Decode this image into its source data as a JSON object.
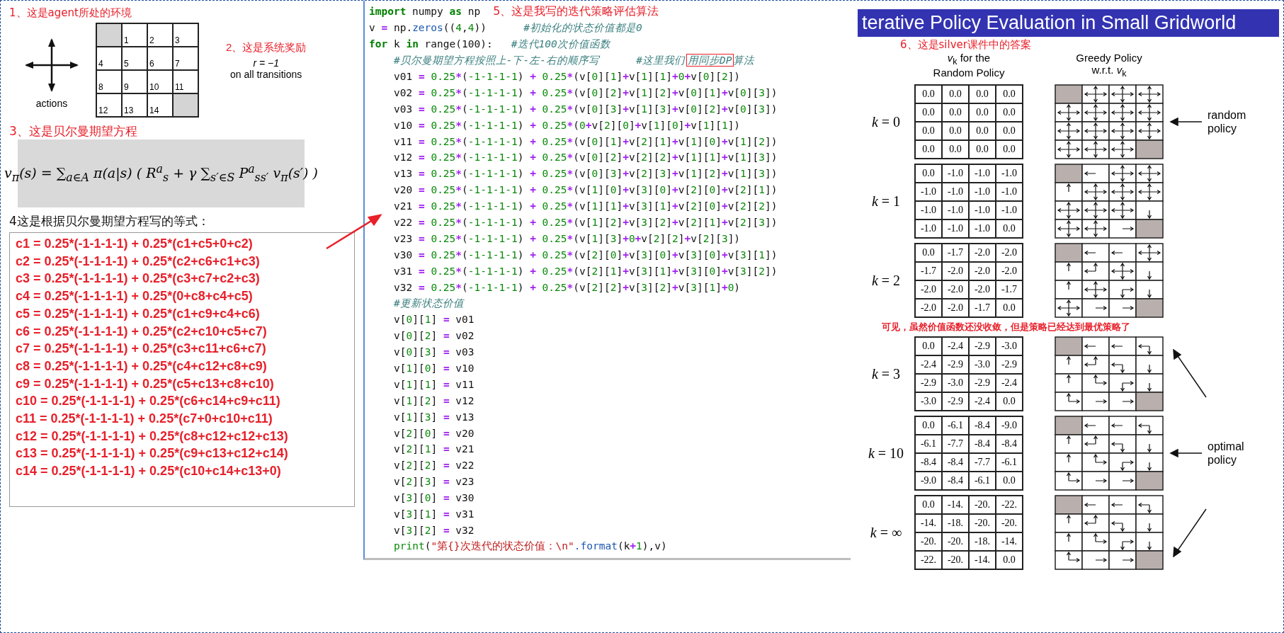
{
  "left": {
    "env_title": "1、这是agent所处的环境",
    "actions_label": "actions",
    "environment": {
      "cells": [
        {
          "terminal": true
        },
        {
          "terminal": false,
          "number": "1"
        },
        {
          "terminal": false,
          "number": "2"
        },
        {
          "terminal": false,
          "number": "3"
        },
        {
          "terminal": false,
          "number": "4"
        },
        {
          "terminal": false,
          "number": "5"
        },
        {
          "terminal": false,
          "number": "6"
        },
        {
          "terminal": false,
          "number": "7"
        },
        {
          "terminal": false,
          "number": "8"
        },
        {
          "terminal": false,
          "number": "9"
        },
        {
          "terminal": false,
          "number": "10"
        },
        {
          "terminal": false,
          "number": "11"
        },
        {
          "terminal": false,
          "number": "12"
        },
        {
          "terminal": false,
          "number": "13"
        },
        {
          "terminal": false,
          "number": "14"
        },
        {
          "terminal": true
        }
      ]
    },
    "reward_title": "2、这是系统奖励",
    "reward": "r = −1",
    "reward_note": "on all transitions",
    "bellman_title": "3、这是贝尔曼期望方程",
    "equation": "v$_{π}$(s) = ∑$_{a∈A}$ π(a|s) ( R$^{a}$$_{s}$ + γ ∑$_{s′∈S}$ P$^{a}$$_{ss′}$ v$_{π}$(s′) )",
    "equations_title": "4这是根据贝尔曼期望方程写的等式：",
    "equations": [
      "c1 = 0.25*(-1-1-1-1) + 0.25*(c1+c5+0+c2)",
      "c2 = 0.25*(-1-1-1-1) + 0.25*(c2+c6+c1+c3)",
      "c3 = 0.25*(-1-1-1-1) + 0.25*(c3+c7+c2+c3)",
      "c4 = 0.25*(-1-1-1-1) + 0.25*(0+c8+c4+c5)",
      "c5 = 0.25*(-1-1-1-1) + 0.25*(c1+c9+c4+c6)",
      "c6 = 0.25*(-1-1-1-1) + 0.25*(c2+c10+c5+c7)",
      "c7 = 0.25*(-1-1-1-1) + 0.25*(c3+c11+c6+c7)",
      "c8 = 0.25*(-1-1-1-1) + 0.25*(c4+c12+c8+c9)",
      "c9 = 0.25*(-1-1-1-1) + 0.25*(c5+c13+c8+c10)",
      "c10 = 0.25*(-1-1-1-1) + 0.25*(c6+c14+c9+c11)",
      "c11 = 0.25*(-1-1-1-1) + 0.25*(c7+0+c10+c11)",
      "c12 = 0.25*(-1-1-1-1) + 0.25*(c8+c12+c12+c13)",
      "c13 = 0.25*(-1-1-1-1) + 0.25*(c9+c13+c12+c14)",
      "c14 = 0.25*(-1-1-1-1) + 0.25*(c10+c14+c13+0)"
    ]
  },
  "code": {
    "lines": [
      {
        "indented": false,
        "note": "5、这是我写的迭代策略评估算法",
        "segments": [
          {
            "kind": "kw",
            "text": "import"
          },
          {
            "kind": "plain",
            "text": " numpy "
          },
          {
            "kind": "kw",
            "text": "as"
          },
          {
            "kind": "plain",
            "text": " np"
          }
        ]
      },
      {
        "indented": false,
        "segments": [
          {
            "kind": "code",
            "text": "v = np."
          },
          {
            "kind": "fn",
            "text": "zeros"
          },
          {
            "kind": "code",
            "text": "((4,4))"
          },
          {
            "kind": "comment",
            "text": "      #初始化的状态价值都是0"
          }
        ]
      },
      {
        "indented": false,
        "segments": [
          {
            "kind": "kw",
            "text": "for"
          },
          {
            "kind": "plain",
            "text": " k "
          },
          {
            "kind": "kw",
            "text": "in"
          },
          {
            "kind": "plain",
            "text": " range(100):"
          },
          {
            "kind": "comment",
            "text": "   #迭代100次价值函数"
          }
        ]
      },
      {
        "indented": true,
        "segments": [
          {
            "kind": "comment",
            "text": "#贝尔曼期望方程按照上-下-左-右的顺序写"
          },
          {
            "kind": "comment",
            "text": "      #这里我们"
          },
          {
            "kind": "boxed",
            "text": "用同步DP"
          },
          {
            "kind": "comment",
            "text": "算法"
          }
        ]
      },
      {
        "indented": true,
        "segments": [
          {
            "kind": "code",
            "text": "v01 = 0.25*(-1-1-1-1) + 0.25*(v[0][1]+v[1][1]+0+v[0][2])"
          }
        ]
      },
      {
        "indented": true,
        "segments": [
          {
            "kind": "code",
            "text": "v02 = 0.25*(-1-1-1-1) + 0.25*(v[0][2]+v[1][2]+v[0][1]+v[0][3])"
          }
        ]
      },
      {
        "indented": true,
        "segments": [
          {
            "kind": "code",
            "text": "v03 = 0.25*(-1-1-1-1) + 0.25*(v[0][3]+v[1][3]+v[0][2]+v[0][3])"
          }
        ]
      },
      {
        "indented": true,
        "segments": [
          {
            "kind": "code",
            "text": "v10 = 0.25*(-1-1-1-1) + 0.25*(0+v[2][0]+v[1][0]+v[1][1])"
          }
        ]
      },
      {
        "indented": true,
        "segments": [
          {
            "kind": "code",
            "text": "v11 = 0.25*(-1-1-1-1) + 0.25*(v[0][1]+v[2][1]+v[1][0]+v[1][2])"
          }
        ]
      },
      {
        "indented": true,
        "segments": [
          {
            "kind": "code",
            "text": "v12 = 0.25*(-1-1-1-1) + 0.25*(v[0][2]+v[2][2]+v[1][1]+v[1][3])"
          }
        ]
      },
      {
        "indented": true,
        "segments": [
          {
            "kind": "code",
            "text": "v13 = 0.25*(-1-1-1-1) + 0.25*(v[0][3]+v[2][3]+v[1][2]+v[1][3])"
          }
        ]
      },
      {
        "indented": true,
        "segments": [
          {
            "kind": "code",
            "text": "v20 = 0.25*(-1-1-1-1) + 0.25*(v[1][0]+v[3][0]+v[2][0]+v[2][1])"
          }
        ]
      },
      {
        "indented": true,
        "segments": [
          {
            "kind": "code",
            "text": "v21 = 0.25*(-1-1-1-1) + 0.25*(v[1][1]+v[3][1]+v[2][0]+v[2][2])"
          }
        ]
      },
      {
        "indented": true,
        "segments": [
          {
            "kind": "code",
            "text": "v22 = 0.25*(-1-1-1-1) + 0.25*(v[1][2]+v[3][2]+v[2][1]+v[2][3])"
          }
        ]
      },
      {
        "indented": true,
        "segments": [
          {
            "kind": "code",
            "text": "v23 = 0.25*(-1-1-1-1) + 0.25*(v[1][3]+0+v[2][2]+v[2][3])"
          }
        ]
      },
      {
        "indented": true,
        "segments": [
          {
            "kind": "code",
            "text": "v30 = 0.25*(-1-1-1-1) + 0.25*(v[2][0]+v[3][0]+v[3][0]+v[3][1])"
          }
        ]
      },
      {
        "indented": true,
        "segments": [
          {
            "kind": "code",
            "text": "v31 = 0.25*(-1-1-1-1) + 0.25*(v[2][1]+v[3][1]+v[3][0]+v[3][2])"
          }
        ]
      },
      {
        "indented": true,
        "segments": [
          {
            "kind": "code",
            "text": "v32 = 0.25*(-1-1-1-1) + 0.25*(v[2][2]+v[3][2]+v[3][1]+0)"
          }
        ]
      },
      {
        "indented": true,
        "segments": [
          {
            "kind": "comment",
            "text": "#更新状态价值"
          }
        ]
      },
      {
        "indented": true,
        "segments": [
          {
            "kind": "code",
            "text": "v[0][1] = v01"
          }
        ]
      },
      {
        "indented": true,
        "segments": [
          {
            "kind": "code",
            "text": "v[0][2] = v02"
          }
        ]
      },
      {
        "indented": true,
        "segments": [
          {
            "kind": "code",
            "text": "v[0][3] = v03"
          }
        ]
      },
      {
        "indented": true,
        "segments": [
          {
            "kind": "code",
            "text": "v[1][0] = v10"
          }
        ]
      },
      {
        "indented": true,
        "segments": [
          {
            "kind": "code",
            "text": "v[1][1] = v11"
          }
        ]
      },
      {
        "indented": true,
        "segments": [
          {
            "kind": "code",
            "text": "v[1][2] = v12"
          }
        ]
      },
      {
        "indented": true,
        "segments": [
          {
            "kind": "code",
            "text": "v[1][3] = v13"
          }
        ]
      },
      {
        "indented": true,
        "segments": [
          {
            "kind": "code",
            "text": "v[2][0] = v20"
          }
        ]
      },
      {
        "indented": true,
        "segments": [
          {
            "kind": "code",
            "text": "v[2][1] = v21"
          }
        ]
      },
      {
        "indented": true,
        "segments": [
          {
            "kind": "code",
            "text": "v[2][2] = v22"
          }
        ]
      },
      {
        "indented": true,
        "segments": [
          {
            "kind": "code",
            "text": "v[2][3] = v23"
          }
        ]
      },
      {
        "indented": true,
        "segments": [
          {
            "kind": "code",
            "text": "v[3][0] = v30"
          }
        ]
      },
      {
        "indented": true,
        "segments": [
          {
            "kind": "code",
            "text": "v[3][1] = v31"
          }
        ]
      },
      {
        "indented": true,
        "segments": [
          {
            "kind": "code",
            "text": "v[3][2] = v32"
          }
        ]
      },
      {
        "indented": true,
        "segments": [
          {
            "kind": "builtin",
            "text": "print"
          },
          {
            "kind": "plain",
            "text": "("
          },
          {
            "kind": "str",
            "text": "\"第{}次迭代的状态价值：\\n\""
          },
          {
            "kind": "fn",
            "text": ".format"
          },
          {
            "kind": "code",
            "text": "(k+1),v)"
          }
        ]
      }
    ]
  },
  "slide": {
    "title": "terative Policy Evaluation in Small Gridworld",
    "annotation": "6、这是silver课件中的答案",
    "value_header": [
      "*v*$_{k}$ for the",
      "Random Policy"
    ],
    "policy_header": [
      "Greedy Policy",
      "w.r.t. *v*$_{k}$"
    ],
    "rows": [
      {
        "label": "*k* = 0",
        "values": [
          "0.0",
          "0.0",
          "0.0",
          "0.0",
          "0.0",
          "0.0",
          "0.0",
          "0.0",
          "0.0",
          "0.0",
          "0.0",
          "0.0",
          "0.0",
          "0.0",
          "0.0",
          "0.0"
        ],
        "policy": [
          {
            "terminal": true,
            "up": false,
            "right": false,
            "down": false,
            "left": false
          },
          {
            "terminal": false,
            "up": true,
            "right": true,
            "down": true,
            "left": true
          },
          {
            "terminal": false,
            "up": true,
            "right": true,
            "down": true,
            "left": true
          },
          {
            "terminal": false,
            "up": true,
            "right": true,
            "down": true,
            "left": true
          },
          {
            "terminal": false,
            "up": true,
            "right": true,
            "down": true,
            "left": true
          },
          {
            "terminal": false,
            "up": true,
            "right": true,
            "down": true,
            "left": true
          },
          {
            "terminal": false,
            "up": true,
            "right": true,
            "down": true,
            "left": true
          },
          {
            "terminal": false,
            "up": true,
            "right": true,
            "down": true,
            "left": true
          },
          {
            "terminal": false,
            "up": true,
            "right": true,
            "down": true,
            "left": true
          },
          {
            "terminal": false,
            "up": true,
            "right": true,
            "down": true,
            "left": true
          },
          {
            "terminal": false,
            "up": true,
            "right": true,
            "down": true,
            "left": true
          },
          {
            "terminal": false,
            "up": true,
            "right": true,
            "down": true,
            "left": true
          },
          {
            "terminal": false,
            "up": true,
            "right": true,
            "down": true,
            "left": true
          },
          {
            "terminal": false,
            "up": true,
            "right": true,
            "down": true,
            "left": true
          },
          {
            "terminal": false,
            "up": true,
            "right": true,
            "down": true,
            "left": true
          },
          {
            "terminal": true,
            "up": false,
            "right": false,
            "down": false,
            "left": false
          }
        ],
        "pointer": {
          "kind": "left"
        },
        "note": "random policy"
      },
      {
        "label": "*k* = 1",
        "values": [
          "0.0",
          "-1.0",
          "-1.0",
          "-1.0",
          "-1.0",
          "-1.0",
          "-1.0",
          "-1.0",
          "-1.0",
          "-1.0",
          "-1.0",
          "-1.0",
          "-1.0",
          "-1.0",
          "-1.0",
          "0.0"
        ],
        "policy": [
          {
            "terminal": true,
            "up": false,
            "right": false,
            "down": false,
            "left": false
          },
          {
            "terminal": false,
            "up": false,
            "right": false,
            "down": false,
            "left": true
          },
          {
            "terminal": false,
            "up": true,
            "right": true,
            "down": true,
            "left": true
          },
          {
            "terminal": false,
            "up": true,
            "right": true,
            "down": true,
            "left": true
          },
          {
            "terminal": false,
            "up": true,
            "right": false,
            "down": false,
            "left": false
          },
          {
            "terminal": false,
            "up": true,
            "right": true,
            "down": true,
            "left": true
          },
          {
            "terminal": false,
            "up": true,
            "right": true,
            "down": true,
            "left": true
          },
          {
            "terminal": false,
            "up": true,
            "right": true,
            "down": true,
            "left": true
          },
          {
            "terminal": false,
            "up": true,
            "right": true,
            "down": true,
            "left": true
          },
          {
            "terminal": false,
            "up": true,
            "right": true,
            "down": true,
            "left": true
          },
          {
            "terminal": false,
            "up": true,
            "right": true,
            "down": true,
            "left": true
          },
          {
            "terminal": false,
            "up": false,
            "right": false,
            "down": true,
            "left": false
          },
          {
            "terminal": false,
            "up": true,
            "right": true,
            "down": true,
            "left": true
          },
          {
            "terminal": false,
            "up": true,
            "right": true,
            "down": true,
            "left": true
          },
          {
            "terminal": false,
            "up": false,
            "right": true,
            "down": false,
            "left": false
          },
          {
            "terminal": true,
            "up": false,
            "right": false,
            "down": false,
            "left": false
          }
        ]
      },
      {
        "label": "*k* = 2",
        "values": [
          "0.0",
          "-1.7",
          "-2.0",
          "-2.0",
          "-1.7",
          "-2.0",
          "-2.0",
          "-2.0",
          "-2.0",
          "-2.0",
          "-2.0",
          "-1.7",
          "-2.0",
          "-2.0",
          "-1.7",
          "0.0"
        ],
        "policy": [
          {
            "terminal": true,
            "up": false,
            "right": false,
            "down": false,
            "left": false
          },
          {
            "terminal": false,
            "up": false,
            "right": false,
            "down": false,
            "left": true
          },
          {
            "terminal": false,
            "up": false,
            "right": false,
            "down": false,
            "left": true
          },
          {
            "terminal": false,
            "up": true,
            "right": true,
            "down": true,
            "left": true
          },
          {
            "terminal": false,
            "up": true,
            "right": false,
            "down": false,
            "left": false
          },
          {
            "terminal": false,
            "up": true,
            "right": false,
            "down": false,
            "left": true
          },
          {
            "terminal": false,
            "up": true,
            "right": true,
            "down": true,
            "left": true
          },
          {
            "terminal": false,
            "up": false,
            "right": false,
            "down": true,
            "left": false
          },
          {
            "terminal": false,
            "up": true,
            "right": false,
            "down": false,
            "left": false
          },
          {
            "terminal": false,
            "up": true,
            "right": true,
            "down": true,
            "left": true
          },
          {
            "terminal": false,
            "up": false,
            "right": true,
            "down": true,
            "left": false
          },
          {
            "terminal": false,
            "up": false,
            "right": false,
            "down": true,
            "left": false
          },
          {
            "terminal": false,
            "up": true,
            "right": true,
            "down": true,
            "left": true
          },
          {
            "terminal": false,
            "up": false,
            "right": true,
            "down": false,
            "left": false
          },
          {
            "terminal": false,
            "up": false,
            "right": true,
            "down": false,
            "left": false
          },
          {
            "terminal": true,
            "up": false,
            "right": false,
            "down": false,
            "left": false
          }
        ]
      },
      {
        "label": "*k* = 3",
        "caption_above": "可见，虽然价值函数还没收敛，但是策略已经达到最优策略了",
        "values": [
          "0.0",
          "-2.4",
          "-2.9",
          "-3.0",
          "-2.4",
          "-2.9",
          "-3.0",
          "-2.9",
          "-2.9",
          "-3.0",
          "-2.9",
          "-2.4",
          "-3.0",
          "-2.9",
          "-2.4",
          "0.0"
        ],
        "policy": [
          {
            "terminal": true,
            "up": false,
            "right": false,
            "down": false,
            "left": false
          },
          {
            "terminal": false,
            "up": false,
            "right": false,
            "down": false,
            "left": true
          },
          {
            "terminal": false,
            "up": false,
            "right": false,
            "down": false,
            "left": true
          },
          {
            "terminal": false,
            "up": false,
            "right": false,
            "down": true,
            "left": true
          },
          {
            "terminal": false,
            "up": true,
            "right": false,
            "down": false,
            "left": false
          },
          {
            "terminal": false,
            "up": true,
            "right": false,
            "down": false,
            "left": true
          },
          {
            "terminal": false,
            "up": false,
            "right": false,
            "down": true,
            "left": true
          },
          {
            "terminal": false,
            "up": false,
            "right": false,
            "down": true,
            "left": false
          },
          {
            "terminal": false,
            "up": true,
            "right": false,
            "down": false,
            "left": false
          },
          {
            "terminal": false,
            "up": true,
            "right": true,
            "down": false,
            "left": false
          },
          {
            "terminal": false,
            "up": false,
            "right": true,
            "down": true,
            "left": false
          },
          {
            "terminal": false,
            "up": false,
            "right": false,
            "down": true,
            "left": false
          },
          {
            "terminal": false,
            "up": true,
            "right": true,
            "down": false,
            "left": false
          },
          {
            "terminal": false,
            "up": false,
            "right": true,
            "down": false,
            "left": false
          },
          {
            "terminal": false,
            "up": false,
            "right": true,
            "down": false,
            "left": false
          },
          {
            "terminal": true,
            "up": false,
            "right": false,
            "down": false,
            "left": false
          }
        ],
        "pointer": {
          "kind": "up-left"
        }
      },
      {
        "label": "*k* = 10",
        "values": [
          "0.0",
          "-6.1",
          "-8.4",
          "-9.0",
          "-6.1",
          "-7.7",
          "-8.4",
          "-8.4",
          "-8.4",
          "-8.4",
          "-7.7",
          "-6.1",
          "-9.0",
          "-8.4",
          "-6.1",
          "0.0"
        ],
        "policy": [
          {
            "terminal": true,
            "up": false,
            "right": false,
            "down": false,
            "left": false
          },
          {
            "terminal": false,
            "up": false,
            "right": false,
            "down": false,
            "left": true
          },
          {
            "terminal": false,
            "up": false,
            "right": false,
            "down": false,
            "left": true
          },
          {
            "terminal": false,
            "up": false,
            "right": false,
            "down": true,
            "left": true
          },
          {
            "terminal": false,
            "up": true,
            "right": false,
            "down": false,
            "left": false
          },
          {
            "terminal": false,
            "up": true,
            "right": false,
            "down": false,
            "left": true
          },
          {
            "terminal": false,
            "up": false,
            "right": false,
            "down": true,
            "left": true
          },
          {
            "terminal": false,
            "up": false,
            "right": false,
            "down": true,
            "left": false
          },
          {
            "terminal": false,
            "up": true,
            "right": false,
            "down": false,
            "left": false
          },
          {
            "terminal": false,
            "up": true,
            "right": true,
            "down": false,
            "left": false
          },
          {
            "terminal": false,
            "up": false,
            "right": true,
            "down": true,
            "left": false
          },
          {
            "terminal": false,
            "up": false,
            "right": false,
            "down": true,
            "left": false
          },
          {
            "terminal": false,
            "up": true,
            "right": true,
            "down": false,
            "left": false
          },
          {
            "terminal": false,
            "up": false,
            "right": true,
            "down": false,
            "left": false
          },
          {
            "terminal": false,
            "up": false,
            "right": true,
            "down": false,
            "left": false
          },
          {
            "terminal": true,
            "up": false,
            "right": false,
            "down": false,
            "left": false
          }
        ],
        "pointer": {
          "kind": "left"
        },
        "note": "optimal policy"
      },
      {
        "label": "*k* = ∞",
        "values": [
          "0.0",
          "-14.",
          "-20.",
          "-22.",
          "-14.",
          "-18.",
          "-20.",
          "-20.",
          "-20.",
          "-20.",
          "-18.",
          "-14.",
          "-22.",
          "-20.",
          "-14.",
          "0.0"
        ],
        "policy": [
          {
            "terminal": true,
            "up": false,
            "right": false,
            "down": false,
            "left": false
          },
          {
            "terminal": false,
            "up": false,
            "right": false,
            "down": false,
            "left": true
          },
          {
            "terminal": false,
            "up": false,
            "right": false,
            "down": false,
            "left": true
          },
          {
            "terminal": false,
            "up": false,
            "right": false,
            "down": true,
            "left": true
          },
          {
            "terminal": false,
            "up": true,
            "right": false,
            "down": false,
            "left": false
          },
          {
            "terminal": false,
            "up": true,
            "right": false,
            "down": false,
            "left": true
          },
          {
            "terminal": false,
            "up": false,
            "right": false,
            "down": true,
            "left": true
          },
          {
            "terminal": false,
            "up": false,
            "right": false,
            "down": true,
            "left": false
          },
          {
            "terminal": false,
            "up": true,
            "right": false,
            "down": false,
            "left": false
          },
          {
            "terminal": false,
            "up": true,
            "right": true,
            "down": false,
            "left": false
          },
          {
            "terminal": false,
            "up": false,
            "right": true,
            "down": true,
            "left": false
          },
          {
            "terminal": false,
            "up": false,
            "right": false,
            "down": true,
            "left": false
          },
          {
            "terminal": false,
            "up": true,
            "right": true,
            "down": false,
            "left": false
          },
          {
            "terminal": false,
            "up": false,
            "right": true,
            "down": false,
            "left": false
          },
          {
            "terminal": false,
            "up": false,
            "right": true,
            "down": false,
            "left": false
          },
          {
            "terminal": true,
            "up": false,
            "right": false,
            "down": false,
            "left": false
          }
        ],
        "pointer": {
          "kind": "down-left"
        }
      }
    ]
  }
}
